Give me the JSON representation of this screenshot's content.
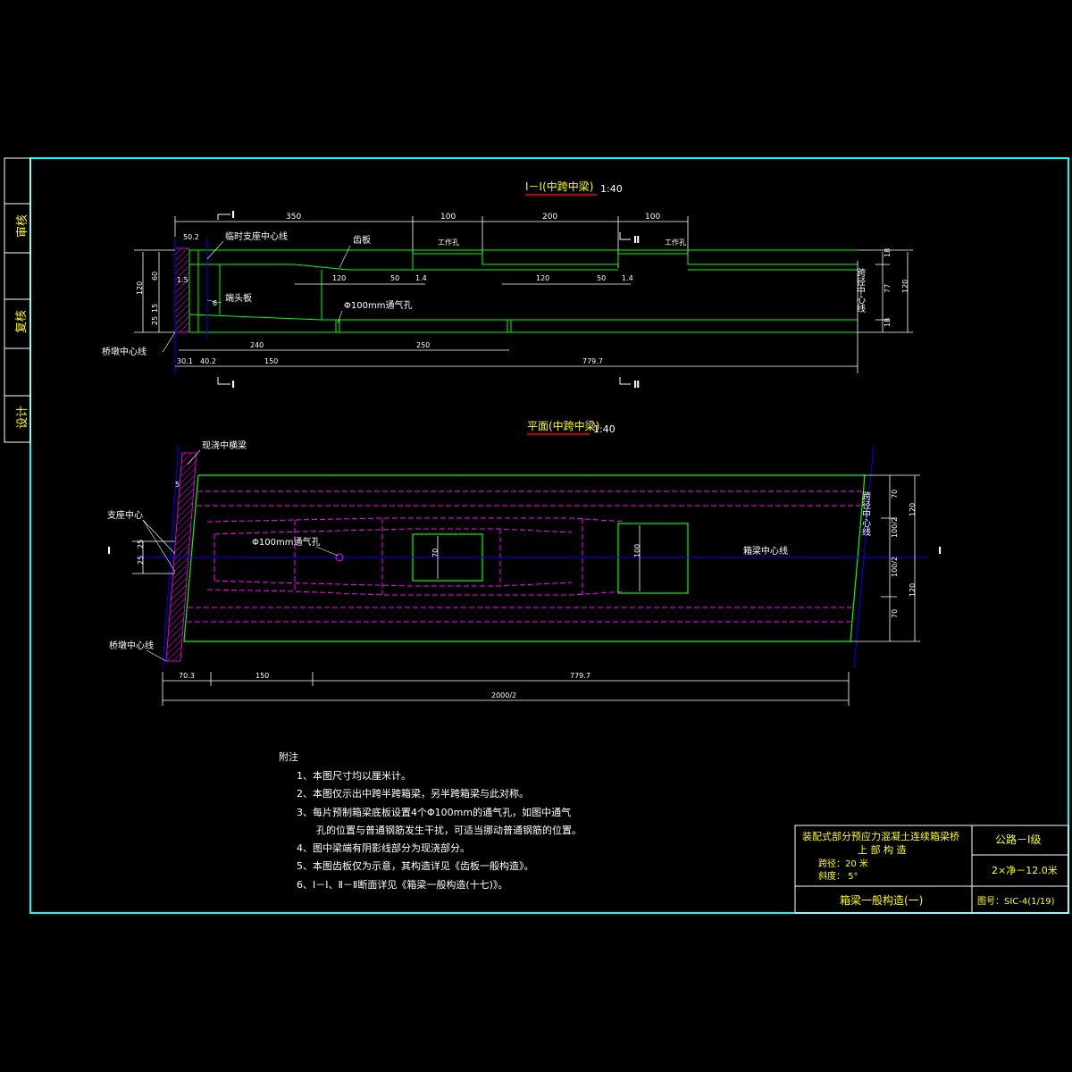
{
  "side_labels": [
    "审核",
    "复核",
    "设计"
  ],
  "section": {
    "title": "Ⅰ－Ⅰ(中跨中梁)",
    "scale": "1:40",
    "top_dims": [
      "350",
      "100",
      "200",
      "100"
    ],
    "cut_I": "Ⅰ",
    "cut_II": "Ⅱ",
    "labels": {
      "temp_support": "临时支座中心线",
      "teeth_plate": "齿板",
      "work_hole_1": "工作孔",
      "work_hole_2": "工作孔",
      "end_plate": "端头板",
      "vent_hole": "Φ100mm通气孔",
      "pier_center": "桥墩中心线",
      "span_center": "跨径中心线"
    },
    "left_dims": [
      "50.2",
      "120",
      "60",
      "15",
      "25",
      "1.5",
      "6"
    ],
    "inner_dims": [
      "120",
      "50",
      "1.4",
      "120",
      "50",
      "1.4"
    ],
    "right_dims": [
      "18",
      "77",
      "18",
      "120"
    ],
    "bottom_dims_1": [
      "240",
      "250"
    ],
    "bottom_dims_2": [
      "30.1",
      "40.2",
      "150",
      "779.7"
    ]
  },
  "plan": {
    "title": "平面(中跨中梁)",
    "scale": "1:40",
    "labels": {
      "cast_diaphragm": "现浇中横梁",
      "support_center": "支座中心",
      "vent_hole": "Φ100mm通气孔",
      "girder_center": "箱梁中心线",
      "pier_center": "桥墩中心线",
      "span_center": "跨径中心线"
    },
    "left_dims": [
      "25",
      "25",
      "5"
    ],
    "inner_dims": [
      "70",
      "100"
    ],
    "right_dims": [
      "70",
      "120",
      "100/2",
      "100/2",
      "120",
      "70"
    ],
    "cut_I": "Ⅰ",
    "bottom_dims": [
      "70.3",
      "150",
      "779.7"
    ],
    "total_dim": "2000/2"
  },
  "notes": {
    "title": "附注",
    "items": [
      "1、本图尺寸均以厘米计。",
      "2、本图仅示出中跨半跨箱梁，另半跨箱梁与此对称。",
      "3、每片预制箱梁底板设置4个Φ100mm的通气孔，如图中通气",
      "孔的位置与普通钢筋发生干扰，可适当挪动普通钢筋的位置。",
      "4、图中梁端有阴影线部分为现浇部分。",
      "5、本图齿板仅为示意，其构造详见《齿板一般构造》。",
      "6、Ⅰ－Ⅰ、Ⅱ－Ⅱ断面详见《箱梁一般构造(十七)》。"
    ]
  },
  "title_block": {
    "project": "装配式部分预应力混凝土连续箱梁桥",
    "part": "上 部 构 造",
    "span": "跨径：20 米",
    "skew": "斜度： 5°",
    "drawing_name": "箱梁一般构造(一)",
    "load_class": "公路－Ⅰ级",
    "width": "2×净－12.0米",
    "drawing_no": "图号：SIC-4(1/19)"
  },
  "colors": {
    "frame": "#00ffff",
    "geometry": "#00ff00",
    "hidden": "#ff00ff",
    "dims": "#ffffff",
    "label": "#ffff00",
    "title_underline": "#ff0000",
    "axis": "#0000ff"
  }
}
